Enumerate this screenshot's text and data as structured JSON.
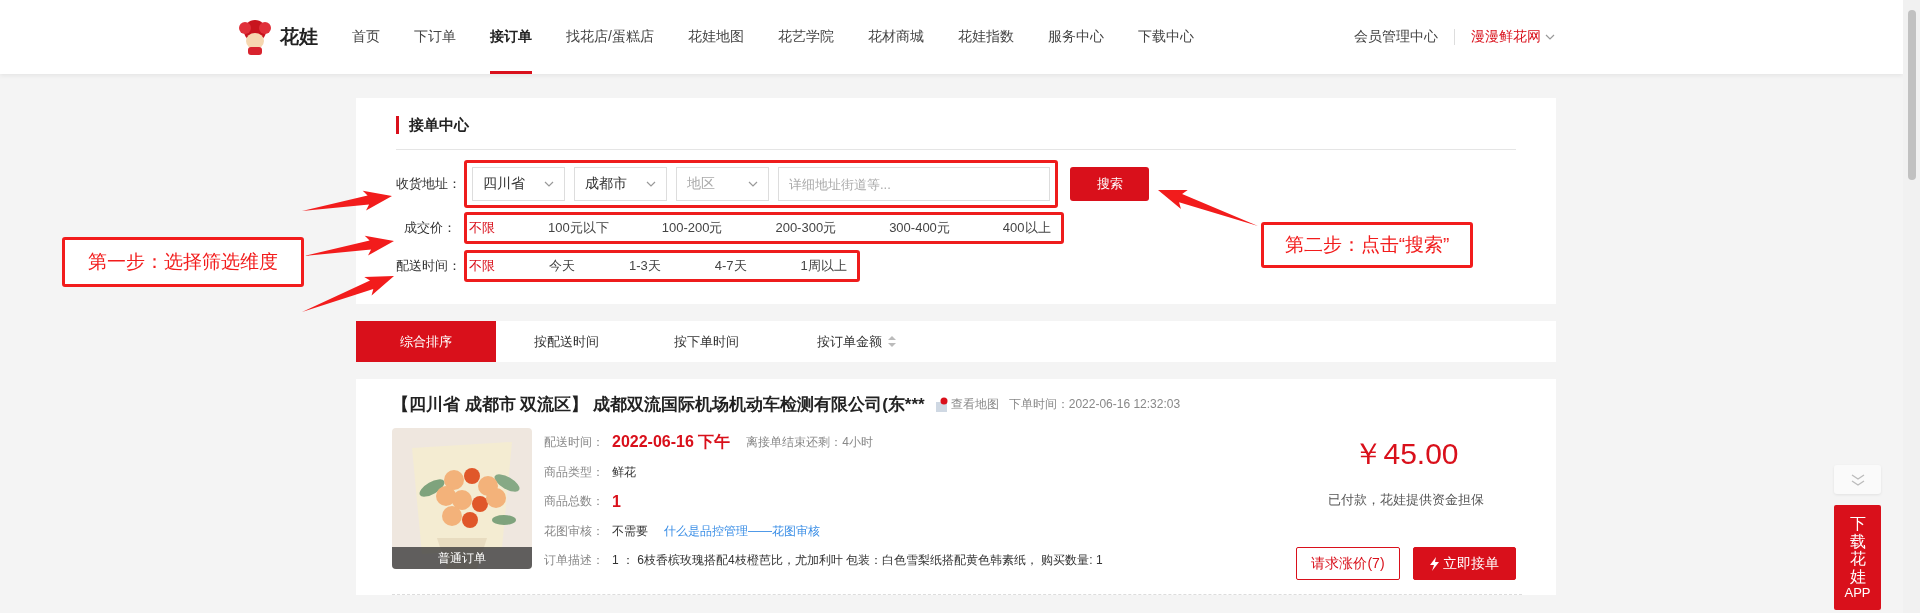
{
  "header": {
    "brand": "花娃",
    "nav": [
      {
        "label": "首页",
        "selected": false
      },
      {
        "label": "下订单",
        "selected": false
      },
      {
        "label": "接订单",
        "selected": true
      },
      {
        "label": "找花店/蛋糕店",
        "selected": false
      },
      {
        "label": "花娃地图",
        "selected": false
      },
      {
        "label": "花艺学院",
        "selected": false
      },
      {
        "label": "花材商城",
        "selected": false
      },
      {
        "label": "花娃指数",
        "selected": false
      },
      {
        "label": "服务中心",
        "selected": false
      },
      {
        "label": "下载中心",
        "selected": false
      }
    ],
    "links": [
      {
        "label": "会员管理中心",
        "kind": "plain"
      },
      {
        "label": "漫漫鲜花网",
        "kind": "dropdown"
      }
    ]
  },
  "panel": {
    "title": "接单中心",
    "address": {
      "label": "收货地址：",
      "highlighted": true,
      "selects": [
        {
          "value": "四川省"
        },
        {
          "value": "成都市"
        },
        {
          "placeholder": "地区"
        }
      ],
      "detail": {
        "placeholder": "详细地址街道等..."
      },
      "search_button": "搜索"
    },
    "filters": [
      {
        "label": "成交价：",
        "highlighted": true,
        "options": [
          {
            "label": "不限",
            "selected": true
          },
          {
            "label": "100元以下",
            "selected": false
          },
          {
            "label": "100-200元",
            "selected": false
          },
          {
            "label": "200-300元",
            "selected": false
          },
          {
            "label": "300-400元",
            "selected": false
          },
          {
            "label": "400以上",
            "selected": false
          }
        ]
      },
      {
        "label": "配送时间：",
        "highlighted": true,
        "options": [
          {
            "label": "不限",
            "selected": true
          },
          {
            "label": "今天",
            "selected": false
          },
          {
            "label": "1-3天",
            "selected": false
          },
          {
            "label": "4-7天",
            "selected": false
          },
          {
            "label": "1周以上",
            "selected": false
          }
        ]
      }
    ]
  },
  "sort_tabs": [
    {
      "label": "综合排序",
      "selected": true,
      "sortable": false
    },
    {
      "label": "按配送时间",
      "selected": false,
      "sortable": false
    },
    {
      "label": "按下单时间",
      "selected": false,
      "sortable": false
    },
    {
      "label": "按订单金额",
      "selected": false,
      "sortable": true
    }
  ],
  "order": {
    "region": "【四川省 成都市 双流区】",
    "name": "成都双流国际机场机动车检测有限公司(东***",
    "map_link": "查看地图",
    "order_time": "下单时间：2022-06-16 12:32:03",
    "image_badge": "普通订单",
    "fields": [
      {
        "label": "配送时间：",
        "value": "2022-06-16 下午",
        "emphasis": true,
        "note": "离接单结束还剩：4小时"
      },
      {
        "label": "商品类型：",
        "value": "鲜花",
        "emphasis": false
      },
      {
        "label": "商品总数：",
        "value": "1",
        "emphasis": true
      },
      {
        "label": "花图审核：",
        "value": "不需要",
        "emphasis": false,
        "link": "什么是品控管理——花图审核"
      },
      {
        "label": "订单描述：",
        "value": "1 ：  6枝香槟玫瑰搭配4枝橙芭比，尤加利叶 包装：白色雪梨纸搭配黄色韩素纸， 购买数量: 1",
        "emphasis": false
      }
    ],
    "price": "￥45.00",
    "guarantee": "已付款，花娃提供资金担保",
    "buttons": [
      {
        "label": "请求涨价(7)",
        "kind": "outline"
      },
      {
        "label": "立即接单",
        "kind": "primary"
      }
    ]
  },
  "side": {
    "download": "下载花娃",
    "download_suffix": "APP"
  },
  "annotations": [
    {
      "text": "第一步：选择筛选维度"
    },
    {
      "text": "第二步：点击“搜索”"
    }
  ]
}
